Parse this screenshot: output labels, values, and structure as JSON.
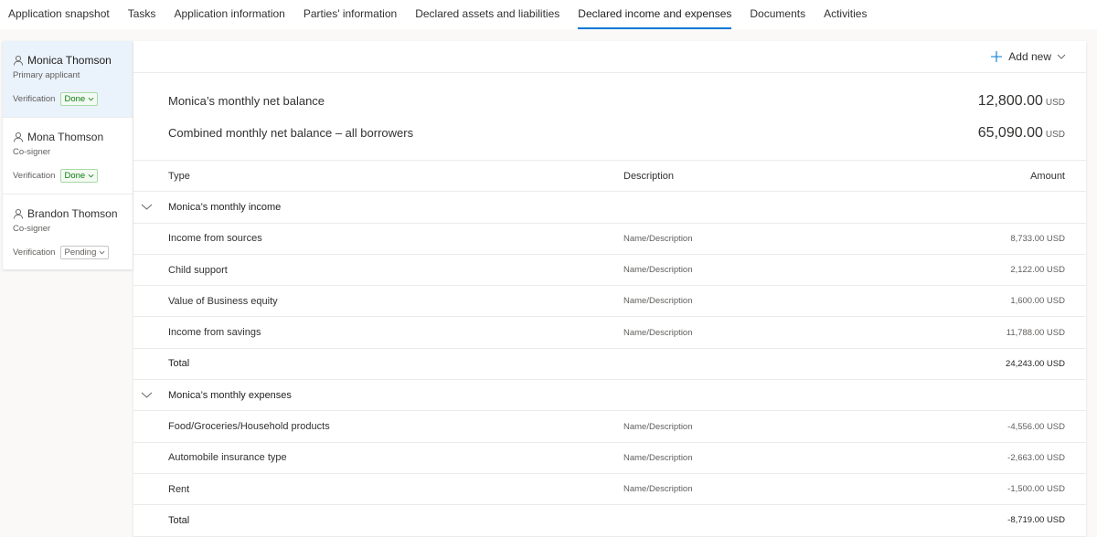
{
  "tabs": [
    {
      "label": "Application snapshot",
      "active": false
    },
    {
      "label": "Tasks",
      "active": false
    },
    {
      "label": "Application information",
      "active": false
    },
    {
      "label": "Parties' information",
      "active": false
    },
    {
      "label": "Declared assets and liabilities",
      "active": false
    },
    {
      "label": "Declared income and expenses",
      "active": true
    },
    {
      "label": "Documents",
      "active": false
    },
    {
      "label": "Activities",
      "active": false
    }
  ],
  "parties": [
    {
      "name": "Monica Thomson",
      "role": "Primary applicant",
      "verification_label": "Verification",
      "verification_status": "Done",
      "selected": true
    },
    {
      "name": "Mona Thomson",
      "role": "Co-signer",
      "verification_label": "Verification",
      "verification_status": "Done",
      "selected": false
    },
    {
      "name": "Brandon Thomson",
      "role": "Co-signer",
      "verification_label": "Verification",
      "verification_status": "Pending",
      "selected": false
    }
  ],
  "toolbar": {
    "add_new_label": "Add new"
  },
  "summary": {
    "net_balance_label": "Monica’s monthly net balance",
    "net_balance_value": "12,800.00",
    "net_balance_unit": "USD",
    "combined_label": "Combined monthly net balance – all borrowers",
    "combined_value": "65,090.00",
    "combined_unit": "USD"
  },
  "table": {
    "headers": {
      "type": "Type",
      "description": "Description",
      "amount": "Amount"
    },
    "groups": [
      {
        "title": "Monica’s monthly income",
        "rows": [
          {
            "type": "Income from sources",
            "description": "Name/Description",
            "amount": "8,733.00 USD"
          },
          {
            "type": "Child support",
            "description": "Name/Description",
            "amount": "2,122.00 USD"
          },
          {
            "type": "Value of Business equity",
            "description": "Name/Description",
            "amount": "1,600.00 USD"
          },
          {
            "type": "Income from savings",
            "description": "Name/Description",
            "amount": "11,788.00 USD"
          }
        ],
        "total_label": "Total",
        "total_amount": "24,243.00  USD"
      },
      {
        "title": "Monica’s monthly expenses",
        "rows": [
          {
            "type": "Food/Groceries/Household products",
            "description": "Name/Description",
            "amount": "-4,556.00 USD"
          },
          {
            "type": "Automobile insurance type",
            "description": "Name/Description",
            "amount": "-2,663.00 USD"
          },
          {
            "type": "Rent",
            "description": "Name/Description",
            "amount": "-1,500.00 USD"
          }
        ],
        "total_label": "Total",
        "total_amount": "-8,719.00 USD"
      }
    ]
  },
  "colors": {
    "accent": "#0078d4",
    "done": "#107c10",
    "selected_bg": "#eaf2fb"
  }
}
